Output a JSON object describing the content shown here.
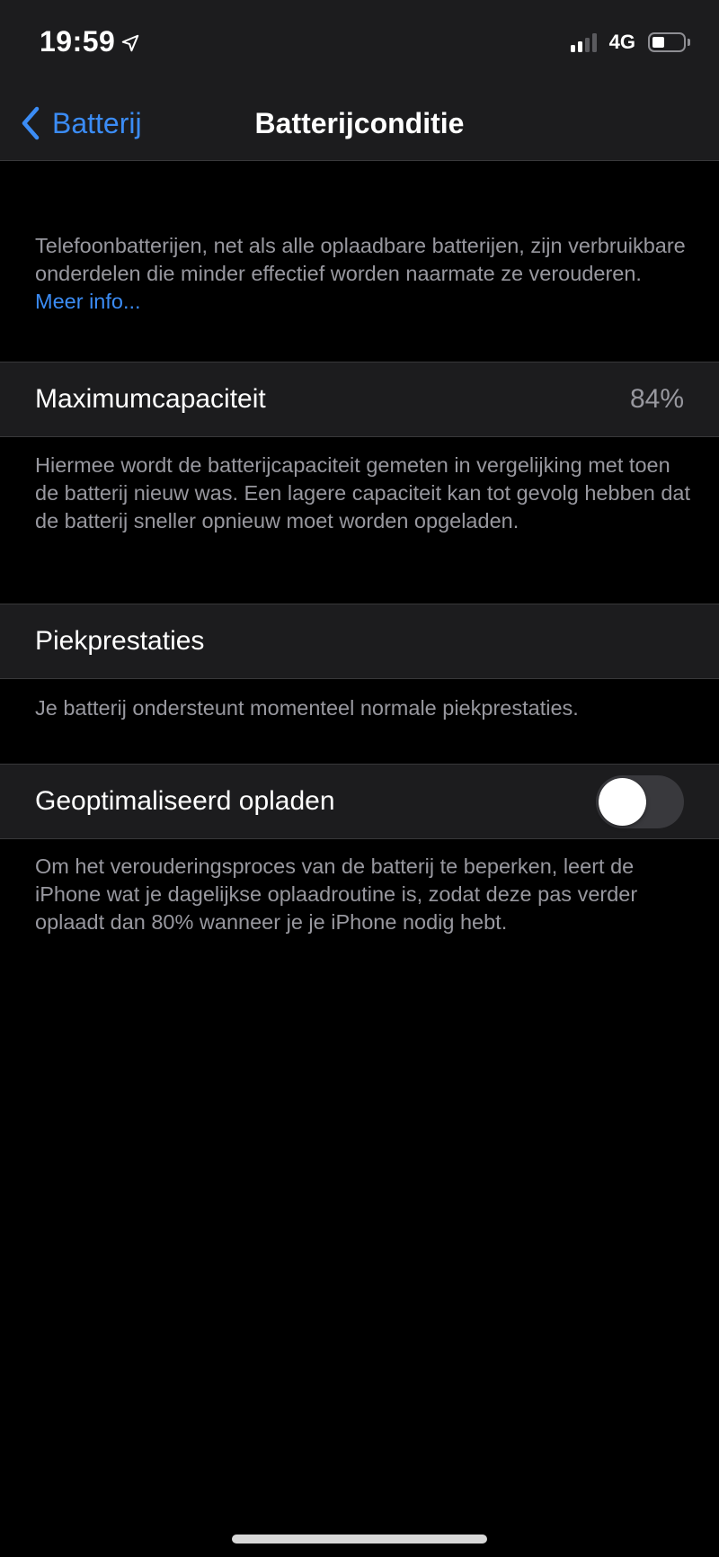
{
  "status_bar": {
    "time": "19:59",
    "location_icon": "location-arrow-icon",
    "network": "4G",
    "signal_bars_active": 2,
    "signal_bars_total": 4,
    "battery_level_fraction": 0.4
  },
  "nav": {
    "back_label": "Batterij",
    "back_icon": "chevron-left-icon",
    "title": "Batterijconditie"
  },
  "intro": {
    "text": "Telefoonbatterijen, net als alle oplaadbare batterijen, zijn verbruikbare onderdelen die minder effectief worden naarmate ze verouderen.",
    "link_label": "Meer info..."
  },
  "max_capacity": {
    "label": "Maximumcapaciteit",
    "value": "84%",
    "footer": "Hiermee wordt de batterijcapaciteit gemeten in vergelijking met toen de batterij nieuw was. Een lagere capaciteit kan tot gevolg hebben dat de batterij sneller opnieuw moet worden opgeladen."
  },
  "peak_performance": {
    "label": "Piekprestaties",
    "footer": "Je batterij ondersteunt momenteel normale piekprestaties."
  },
  "optimized_charging": {
    "label": "Geoptimaliseerd opladen",
    "enabled": false,
    "footer": "Om het verouderingsproces van de batterij te beperken, leert de iPhone wat je dagelijkse oplaadroutine is, zodat deze pas verder oplaadt dan 80% wanneer je je iPhone nodig hebt."
  },
  "colors": {
    "accent": "#3b8cf5",
    "background": "#000000",
    "cell_background": "#1c1c1e",
    "secondary_text": "#98989f",
    "toggle_off": "#39393d"
  }
}
